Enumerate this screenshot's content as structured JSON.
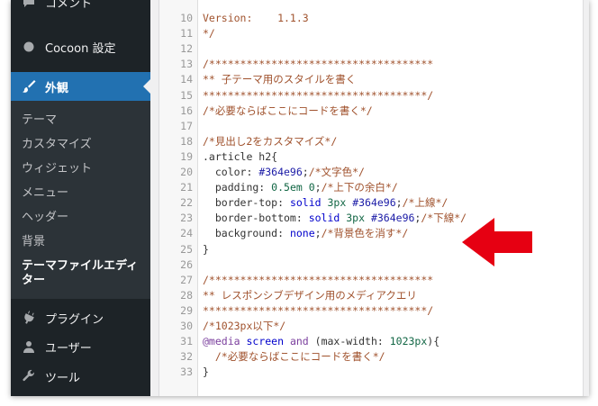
{
  "sidebar": {
    "top_partial": "コメント",
    "items": [
      {
        "label": "Cocoon 設定",
        "icon": "cocoon-circle-icon"
      },
      {
        "label": "外観",
        "icon": "paintbrush-icon",
        "active": true
      },
      {
        "label": "プラグイン",
        "icon": "plugin-icon"
      },
      {
        "label": "ユーザー",
        "icon": "users-icon"
      },
      {
        "label": "ツール",
        "icon": "wrench-icon"
      }
    ],
    "submenu": [
      {
        "label": "テーマ"
      },
      {
        "label": "カスタマイズ"
      },
      {
        "label": "ウィジェット"
      },
      {
        "label": "メニュー"
      },
      {
        "label": "ヘッダー"
      },
      {
        "label": "背景"
      },
      {
        "label": "テーマファイルエディター",
        "current": true
      }
    ]
  },
  "editor": {
    "lines": [
      {
        "n": "10",
        "tokens": [
          {
            "t": "Version:    1.1.3",
            "c": "comment"
          }
        ]
      },
      {
        "n": "11",
        "tokens": [
          {
            "t": "*/",
            "c": "comment"
          }
        ]
      },
      {
        "n": "12",
        "tokens": []
      },
      {
        "n": "13",
        "tokens": [
          {
            "t": "/************************************",
            "c": "comment"
          }
        ]
      },
      {
        "n": "14",
        "tokens": [
          {
            "t": "** 子テーマ用のスタイルを書く",
            "c": "comment"
          }
        ]
      },
      {
        "n": "15",
        "tokens": [
          {
            "t": "************************************/",
            "c": "comment"
          }
        ]
      },
      {
        "n": "16",
        "tokens": [
          {
            "t": "/*必要ならばここにコードを書く*/",
            "c": "comment"
          }
        ]
      },
      {
        "n": "17",
        "tokens": []
      },
      {
        "n": "18",
        "tokens": [
          {
            "t": "/*見出し2をカスタマイズ*/",
            "c": "comment"
          }
        ]
      },
      {
        "n": "19",
        "tokens": [
          {
            "t": ".article h2{",
            "c": "default"
          }
        ]
      },
      {
        "n": "20",
        "tokens": [
          {
            "t": "  color: ",
            "c": "prop"
          },
          {
            "t": "#364e96",
            "c": "hex"
          },
          {
            "t": ";",
            "c": "default"
          },
          {
            "t": "/*文字色*/",
            "c": "comment"
          }
        ]
      },
      {
        "n": "21",
        "tokens": [
          {
            "t": "  padding: ",
            "c": "prop"
          },
          {
            "t": "0.5em 0",
            "c": "num"
          },
          {
            "t": ";",
            "c": "default"
          },
          {
            "t": "/*上下の余白*/",
            "c": "comment"
          }
        ]
      },
      {
        "n": "22",
        "tokens": [
          {
            "t": "  border-top: ",
            "c": "prop"
          },
          {
            "t": "solid ",
            "c": "val"
          },
          {
            "t": "3px ",
            "c": "num"
          },
          {
            "t": "#364e96",
            "c": "hex"
          },
          {
            "t": ";",
            "c": "default"
          },
          {
            "t": "/*上線*/",
            "c": "comment"
          }
        ]
      },
      {
        "n": "23",
        "tokens": [
          {
            "t": "  border-bottom: ",
            "c": "prop"
          },
          {
            "t": "solid ",
            "c": "val"
          },
          {
            "t": "3px ",
            "c": "num"
          },
          {
            "t": "#364e96",
            "c": "hex"
          },
          {
            "t": ";",
            "c": "default"
          },
          {
            "t": "/*下線*/",
            "c": "comment"
          }
        ]
      },
      {
        "n": "24",
        "tokens": [
          {
            "t": "  background: ",
            "c": "prop"
          },
          {
            "t": "none",
            "c": "val"
          },
          {
            "t": ";",
            "c": "default"
          },
          {
            "t": "/*背景色を消す*/",
            "c": "comment"
          }
        ]
      },
      {
        "n": "25",
        "tokens": [
          {
            "t": "}",
            "c": "default"
          }
        ]
      },
      {
        "n": "26",
        "tokens": []
      },
      {
        "n": "27",
        "tokens": [
          {
            "t": "/************************************",
            "c": "comment"
          }
        ]
      },
      {
        "n": "28",
        "tokens": [
          {
            "t": "** レスポンシブデザイン用のメディアクエリ",
            "c": "comment"
          }
        ]
      },
      {
        "n": "29",
        "tokens": [
          {
            "t": "************************************/",
            "c": "comment"
          }
        ]
      },
      {
        "n": "30",
        "tokens": [
          {
            "t": "/*1023px以下*/",
            "c": "comment"
          }
        ]
      },
      {
        "n": "31",
        "tokens": [
          {
            "t": "@media ",
            "c": "at"
          },
          {
            "t": "screen ",
            "c": "val"
          },
          {
            "t": "and ",
            "c": "kw"
          },
          {
            "t": "(max-width: ",
            "c": "default"
          },
          {
            "t": "1023px",
            "c": "num"
          },
          {
            "t": "){",
            "c": "default"
          }
        ]
      },
      {
        "n": "32",
        "tokens": [
          {
            "t": "  /*必要ならばここにコードを書く*/",
            "c": "comment"
          }
        ]
      },
      {
        "n": "33",
        "tokens": [
          {
            "t": "}",
            "c": "default"
          }
        ]
      }
    ]
  },
  "colors": {
    "sidebar_bg": "#1d2327",
    "submenu_bg": "#2c3338",
    "active_bg": "#2271b1",
    "arrow": "#e60012"
  }
}
